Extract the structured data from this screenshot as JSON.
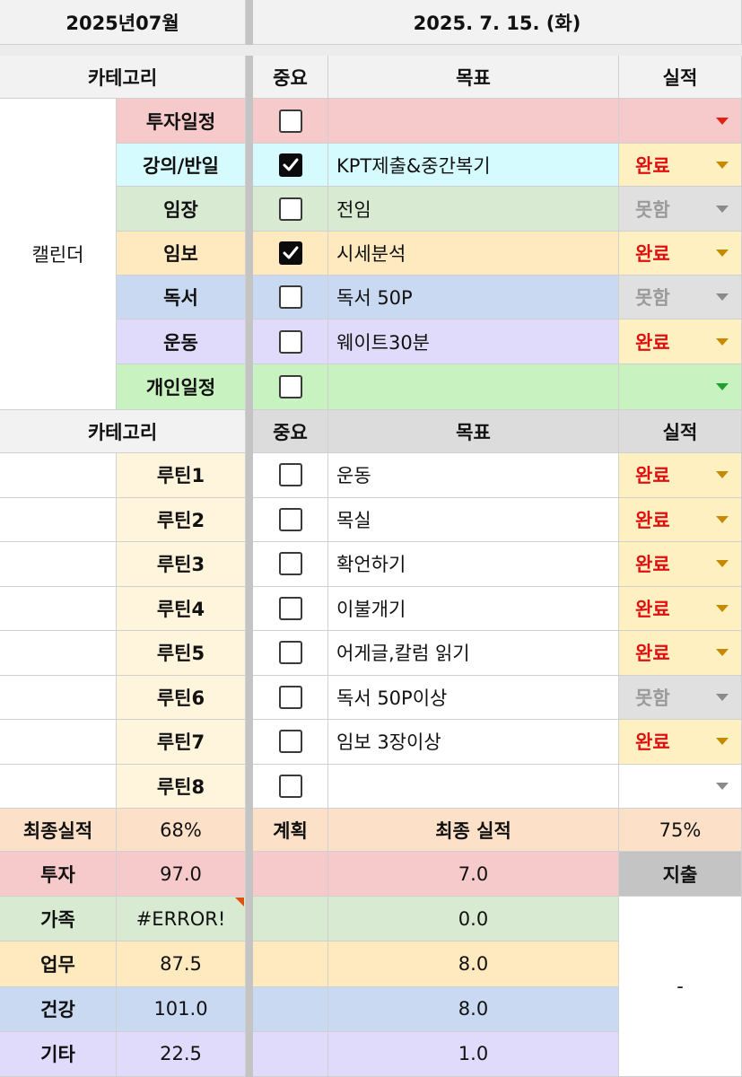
{
  "header": {
    "month": "2025년07월",
    "date": "2025. 7. 15. (화)"
  },
  "section1": {
    "col_category": "카테고리",
    "col_important": "중요",
    "col_goal": "목표",
    "col_result": "실적",
    "group_label": "캘린더",
    "rows": [
      {
        "category": "투자일정",
        "checked": false,
        "goal": "",
        "result": ""
      },
      {
        "category": "강의/반일",
        "checked": true,
        "goal": "KPT제출&중간복기",
        "result": "완료"
      },
      {
        "category": "임장",
        "checked": false,
        "goal": "전임",
        "result": "못함"
      },
      {
        "category": "임보",
        "checked": true,
        "goal": "시세분석",
        "result": "완료"
      },
      {
        "category": "독서",
        "checked": false,
        "goal": "독서 50P",
        "result": "못함"
      },
      {
        "category": "운동",
        "checked": false,
        "goal": "웨이트30분",
        "result": "완료"
      },
      {
        "category": "개인일정",
        "checked": false,
        "goal": "",
        "result": ""
      }
    ]
  },
  "section2": {
    "col_category": "카테고리",
    "col_important": "중요",
    "col_goal": "목표",
    "col_result": "실적",
    "rows": [
      {
        "category": "루틴1",
        "checked": false,
        "goal": "운동",
        "result": "완료"
      },
      {
        "category": "루틴2",
        "checked": false,
        "goal": "목실",
        "result": "완료"
      },
      {
        "category": "루틴3",
        "checked": false,
        "goal": "확언하기",
        "result": "완료"
      },
      {
        "category": "루틴4",
        "checked": false,
        "goal": "이불개기",
        "result": "완료"
      },
      {
        "category": "루틴5",
        "checked": false,
        "goal": "어게글,칼럼 읽기",
        "result": "완료"
      },
      {
        "category": "루틴6",
        "checked": false,
        "goal": "독서 50P이상",
        "result": "못함"
      },
      {
        "category": "루틴7",
        "checked": false,
        "goal": "임보 3장이상",
        "result": "완료"
      },
      {
        "category": "루틴8",
        "checked": false,
        "goal": "",
        "result": ""
      }
    ]
  },
  "summary": {
    "final_label": "최종실적",
    "final_value": "68%",
    "plan_label": "계획",
    "final_result_label": "최종 실적",
    "final_result_value": "75%",
    "expense_label": "지출",
    "expense_value": "-",
    "rows": [
      {
        "label": "투자",
        "value": "97.0",
        "plan": "",
        "result": "7.0"
      },
      {
        "label": "가족",
        "value": "#ERROR!",
        "plan": "",
        "result": "0.0"
      },
      {
        "label": "업무",
        "value": "87.5",
        "plan": "",
        "result": "8.0"
      },
      {
        "label": "건강",
        "value": "101.0",
        "plan": "",
        "result": "8.0"
      },
      {
        "label": "기타",
        "value": "22.5",
        "plan": "",
        "result": "1.0"
      }
    ]
  },
  "colors": {
    "invest": "#f6caca",
    "lecture": "#d6fbff",
    "field": "#d9ead3",
    "report": "#ffe9bf",
    "reading": "#cad9f2",
    "exercise": "#e0dbfb",
    "personal": "#c8f2c0",
    "routine": "#fff4dc",
    "final": "#fce0c8",
    "done_bg": "#fff0c2",
    "done_text": "#e01010",
    "fail_bg": "#e0e0e0",
    "fail_text": "#9a9a9a"
  }
}
